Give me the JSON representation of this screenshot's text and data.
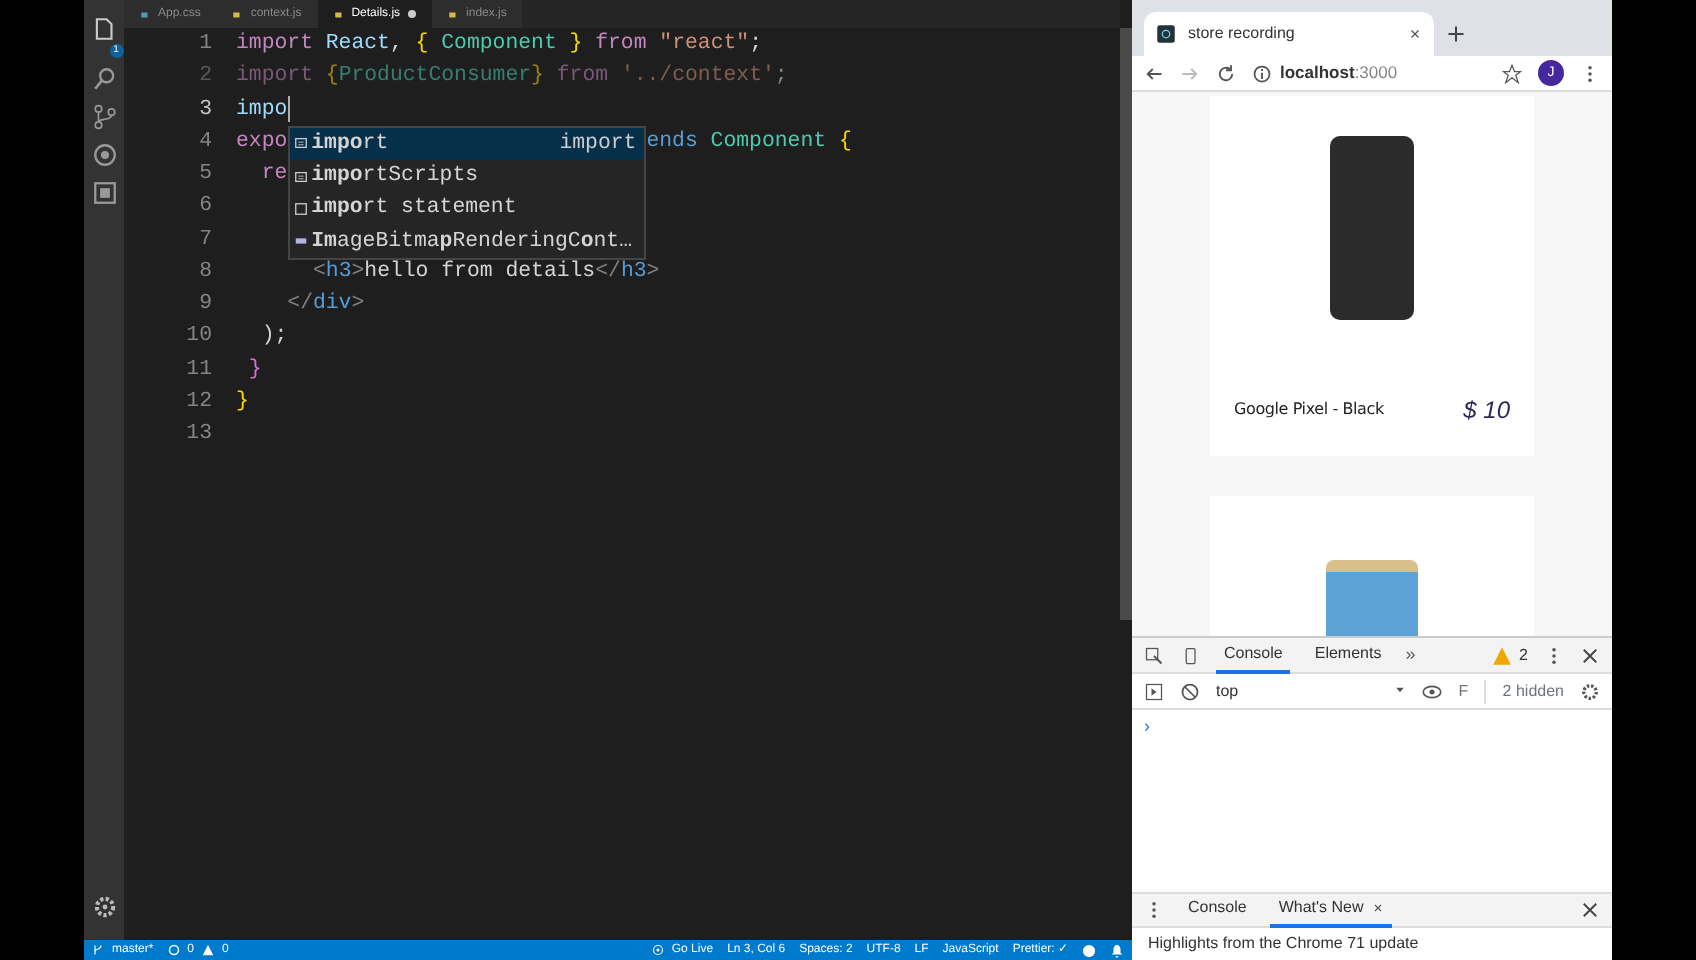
{
  "editor": {
    "tabs": [
      {
        "label": "App.css",
        "selected": false,
        "modified": false
      },
      {
        "label": "context.js",
        "selected": false,
        "modified": false
      },
      {
        "label": "Details.js",
        "selected": true,
        "modified": true
      },
      {
        "label": "index.js",
        "selected": false,
        "modified": false
      }
    ],
    "explorer_badge": "1",
    "lines": [
      {
        "number": "1",
        "tokens": [
          {
            "kind": "kw",
            "t": "import"
          },
          {
            "kind": "id",
            "t": " React"
          },
          {
            "kind": "punct",
            "t": ", "
          },
          {
            "kind": "brace",
            "t": "{"
          },
          {
            "kind": "type",
            "t": " Component"
          },
          {
            "kind": "brace",
            "t": " }"
          },
          {
            "kind": "kw",
            "t": " from"
          },
          {
            "kind": "str",
            "t": " \"react\""
          },
          {
            "kind": "punct",
            "t": ";"
          }
        ]
      },
      {
        "number": "2",
        "faded": true,
        "tokens": [
          {
            "kind": "kw",
            "t": "import"
          },
          {
            "kind": "brace",
            "t": " {"
          },
          {
            "kind": "type",
            "t": "ProductConsumer"
          },
          {
            "kind": "brace",
            "t": "}"
          },
          {
            "kind": "kw",
            "t": " from"
          },
          {
            "kind": "str",
            "t": " '../context'"
          },
          {
            "kind": "punct",
            "t": ";"
          }
        ]
      },
      {
        "number": "3",
        "current": true,
        "tokens": [
          {
            "kind": "id",
            "t": "impo"
          }
        ]
      },
      {
        "number": "4",
        "tokens": [
          {
            "kind": "kw",
            "t": "expo"
          }
        ],
        "tail": [
          {
            "kind": "kw2",
            "t": "ends"
          },
          {
            "kind": "type",
            "t": " Component"
          },
          {
            "kind": "brace",
            "t": " {"
          }
        ]
      },
      {
        "number": "5",
        "tokens": [
          {
            "kind": "kw",
            "t": "  re"
          }
        ]
      },
      {
        "number": "6"
      },
      {
        "number": "7"
      },
      {
        "number": "8",
        "tokens": [
          {
            "kind": "tag",
            "t": "      <"
          },
          {
            "kind": "tagname",
            "t": "h3"
          },
          {
            "kind": "tag",
            "t": ">"
          },
          {
            "kind": "text",
            "t": "hello from details"
          },
          {
            "kind": "tag",
            "t": "</"
          },
          {
            "kind": "tagname",
            "t": "h3"
          },
          {
            "kind": "tag",
            "t": ">"
          }
        ]
      },
      {
        "number": "9",
        "tokens": [
          {
            "kind": "tag",
            "t": "    </"
          },
          {
            "kind": "tagname",
            "t": "div"
          },
          {
            "kind": "tag",
            "t": ">"
          }
        ]
      },
      {
        "number": "10",
        "tokens": [
          {
            "kind": "punct",
            "t": "  );"
          }
        ]
      },
      {
        "number": "11",
        "tokens": [
          {
            "kind": "brace2",
            "t": " }"
          }
        ]
      },
      {
        "number": "12",
        "tokens": [
          {
            "kind": "brace",
            "t": "}"
          }
        ]
      },
      {
        "number": "13"
      }
    ],
    "suggestions": [
      {
        "kind": "keyword",
        "label": "**impo**rt",
        "detail": "import",
        "selected": true
      },
      {
        "kind": "keyword",
        "label": "**impo**rtScripts",
        "selected": false
      },
      {
        "kind": "snippet",
        "label": "**impo**rt statement",
        "selected": false
      },
      {
        "kind": "field",
        "label": "**Im**ageBitma**p**RenderingC**o**nt…",
        "selected": false
      }
    ],
    "status_bar": {
      "branch": "master*",
      "errors": "0",
      "warnings": "0",
      "items": [
        "Go Live",
        "Ln 3, Col 6",
        "Spaces: 2",
        "UTF-8",
        "LF",
        "JavaScript",
        "Prettier: ✓"
      ]
    }
  },
  "browser": {
    "tab_title": "store recording",
    "url_host": "localhost",
    "url_port": ":3000",
    "avatar": "J",
    "products": [
      {
        "kind": "listing",
        "name": "Google Pixel - Black",
        "price": "$ 10"
      },
      {
        "kind": "photo"
      }
    ],
    "devtools": {
      "tabs": [
        {
          "label": "Console",
          "selected": true
        },
        {
          "label": "Elements",
          "selected": false
        }
      ],
      "more": "»",
      "warning_count": "2",
      "context": "top",
      "filter_placeholder": "F",
      "hidden": "2 hidden",
      "prompt": "›",
      "drawer_tabs": [
        {
          "label": "Console",
          "selected": false,
          "closable": false
        },
        {
          "label": "What's New",
          "selected": true,
          "closable": true
        }
      ],
      "drawer_text": "Highlights from the Chrome 71 update"
    }
  }
}
